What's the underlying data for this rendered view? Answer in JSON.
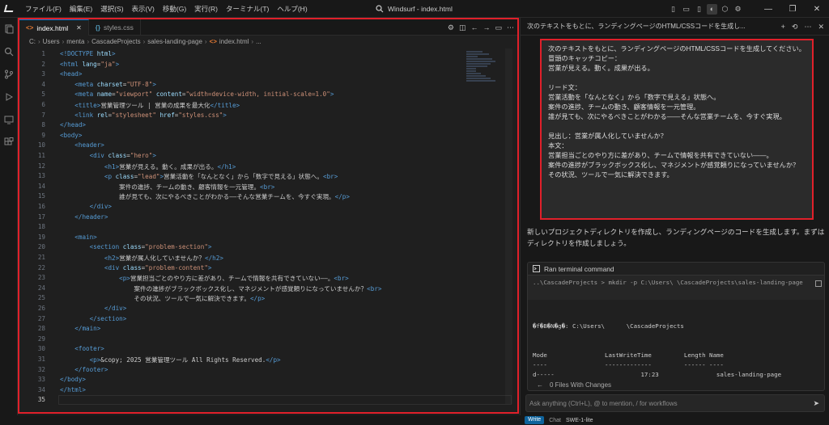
{
  "titlebar": {
    "menus": [
      "ファイル(F)",
      "編集(E)",
      "選択(S)",
      "表示(V)",
      "移動(G)",
      "実行(R)",
      "ターミナル(T)",
      "ヘルプ(H)"
    ],
    "search_text": "Windsurf - index.html",
    "window_controls": [
      "—",
      "❐",
      "✕"
    ]
  },
  "editor": {
    "tabs": [
      {
        "icon": "<>",
        "label": "index.html",
        "active": true
      },
      {
        "icon": "{}",
        "label": "styles.css",
        "active": false
      }
    ],
    "breadcrumb": [
      "C:",
      "Users",
      "menta",
      "CascadeProjects",
      "sales-landing-page",
      "index.html",
      "..."
    ],
    "current_line": 35,
    "lines": [
      [
        [
          "t",
          "<!DOCTYPE "
        ],
        [
          "a",
          "html"
        ],
        [
          "t",
          ">"
        ]
      ],
      [
        [
          "t",
          "<html "
        ],
        [
          "a",
          "lang"
        ],
        [
          "e",
          "="
        ],
        [
          "s",
          "\"ja\""
        ],
        [
          "t",
          ">"
        ]
      ],
      [
        [
          "t",
          "<head>"
        ]
      ],
      [
        [
          "e",
          "    "
        ],
        [
          "t",
          "<meta "
        ],
        [
          "a",
          "charset"
        ],
        [
          "e",
          "="
        ],
        [
          "s",
          "\"UTF-8\""
        ],
        [
          "t",
          ">"
        ]
      ],
      [
        [
          "e",
          "    "
        ],
        [
          "t",
          "<meta "
        ],
        [
          "a",
          "name"
        ],
        [
          "e",
          "="
        ],
        [
          "s",
          "\"viewport\""
        ],
        [
          "e",
          " "
        ],
        [
          "a",
          "content"
        ],
        [
          "e",
          "="
        ],
        [
          "s",
          "\"width=device-width, initial-scale=1.0\""
        ],
        [
          "t",
          ">"
        ]
      ],
      [
        [
          "e",
          "    "
        ],
        [
          "t",
          "<title>"
        ],
        [
          "e",
          "営業管理ツール | 営業の成果を最大化"
        ],
        [
          "t",
          "</title>"
        ]
      ],
      [
        [
          "e",
          "    "
        ],
        [
          "t",
          "<link "
        ],
        [
          "a",
          "rel"
        ],
        [
          "e",
          "="
        ],
        [
          "s",
          "\"stylesheet\""
        ],
        [
          "e",
          " "
        ],
        [
          "a",
          "href"
        ],
        [
          "e",
          "="
        ],
        [
          "s",
          "\"styles.css\""
        ],
        [
          "t",
          ">"
        ]
      ],
      [
        [
          "t",
          "</head>"
        ]
      ],
      [
        [
          "t",
          "<body>"
        ]
      ],
      [
        [
          "e",
          "    "
        ],
        [
          "t",
          "<header>"
        ]
      ],
      [
        [
          "e",
          "        "
        ],
        [
          "t",
          "<div "
        ],
        [
          "a",
          "class"
        ],
        [
          "e",
          "="
        ],
        [
          "s",
          "\"hero\""
        ],
        [
          "t",
          ">"
        ]
      ],
      [
        [
          "e",
          "            "
        ],
        [
          "t",
          "<h1>"
        ],
        [
          "e",
          "営業が見える。動く。成果が出る。"
        ],
        [
          "t",
          "</h1>"
        ]
      ],
      [
        [
          "e",
          "            "
        ],
        [
          "t",
          "<p "
        ],
        [
          "a",
          "class"
        ],
        [
          "e",
          "="
        ],
        [
          "s",
          "\"lead\""
        ],
        [
          "t",
          ">"
        ],
        [
          "e",
          "営業活動を「なんとなく」から「数字で見える」状態へ。"
        ],
        [
          "t",
          "<br>"
        ]
      ],
      [
        [
          "e",
          "                案件の進捗、チームの動き、顧客情報を一元管理。"
        ],
        [
          "t",
          "<br>"
        ]
      ],
      [
        [
          "e",
          "                誰が見ても、次にやるべきことがわかる——そんな営業チームを、今すぐ実現。"
        ],
        [
          "t",
          "</p>"
        ]
      ],
      [
        [
          "e",
          "        "
        ],
        [
          "t",
          "</div>"
        ]
      ],
      [
        [
          "e",
          "    "
        ],
        [
          "t",
          "</header>"
        ]
      ],
      [],
      [
        [
          "e",
          "    "
        ],
        [
          "t",
          "<main>"
        ]
      ],
      [
        [
          "e",
          "        "
        ],
        [
          "t",
          "<section "
        ],
        [
          "a",
          "class"
        ],
        [
          "e",
          "="
        ],
        [
          "s",
          "\"problem-section\""
        ],
        [
          "t",
          ">"
        ]
      ],
      [
        [
          "e",
          "            "
        ],
        [
          "t",
          "<h2>"
        ],
        [
          "e",
          "営業が属人化していませんか？"
        ],
        [
          "t",
          "</h2>"
        ]
      ],
      [
        [
          "e",
          "            "
        ],
        [
          "t",
          "<div "
        ],
        [
          "a",
          "class"
        ],
        [
          "e",
          "="
        ],
        [
          "s",
          "\"problem-content\""
        ],
        [
          "t",
          ">"
        ]
      ],
      [
        [
          "e",
          "                "
        ],
        [
          "t",
          "<p>"
        ],
        [
          "e",
          "営業担当ごとのやり方に差があり、チームで情報を共有できていない——。"
        ],
        [
          "t",
          "<br>"
        ]
      ],
      [
        [
          "e",
          "                    案件の進捗がブラックボックス化し、マネジメントが感覚頼りになっていませんか？"
        ],
        [
          "t",
          "<br>"
        ]
      ],
      [
        [
          "e",
          "                    その状況、ツールで一気に解決できます。"
        ],
        [
          "t",
          "</p>"
        ]
      ],
      [
        [
          "e",
          "            "
        ],
        [
          "t",
          "</div>"
        ]
      ],
      [
        [
          "e",
          "        "
        ],
        [
          "t",
          "</section>"
        ]
      ],
      [
        [
          "e",
          "    "
        ],
        [
          "t",
          "</main>"
        ]
      ],
      [],
      [
        [
          "e",
          "    "
        ],
        [
          "t",
          "<footer>"
        ]
      ],
      [
        [
          "e",
          "        "
        ],
        [
          "t",
          "<p>"
        ],
        [
          "e",
          "&copy; 2025 営業管理ツール All Rights Reserved."
        ],
        [
          "t",
          "</p>"
        ]
      ],
      [
        [
          "e",
          "    "
        ],
        [
          "t",
          "</footer>"
        ]
      ],
      [
        [
          "t",
          "</body>"
        ]
      ],
      [
        [
          "t",
          "</html>"
        ]
      ],
      []
    ]
  },
  "panel": {
    "header_title": "次のテキストをもとに、ランディングページのHTML/CSSコードを生成し...",
    "header_actions": [
      "+",
      "⟲",
      "⋯",
      "✕"
    ],
    "user_message": "次のテキストをもとに、ランディングページのHTML/CSSコードを生成してください。\n冒頭のキャッチコピー：\n営業が見える。動く。成果が出る。\n\nリード文：\n営業活動を「なんとなく」から「数字で見える」状態へ。\n案件の進捗、チームの動き、顧客情報を一元管理。\n誰が見ても、次にやるべきことがわかる——そんな営業チームを、今すぐ実現。\n\n見出し：営業が属人化していませんか？\n本文：\n営業担当ごとのやり方に差があり、チームで情報を共有できていない——。\n案件の進捗がブラックボックス化し、マネジメントが感覚頼りになっていませんか？\nその状況、ツールで一気に解決できます。",
    "assistant_text": "新しいプロジェクトディレクトリを作成し、ランディングページのコードを生成します。まずはディレクトリを作成しましょう。",
    "terminal": {
      "title": "Ran terminal command",
      "command": "..\\CascadeProjects > mkdir -p C:\\Users\\      \\CascadeProjects\\sales-landing-page",
      "garbled": "�f�B�N�g�: C:\\Users\\      \\CascadeProjects",
      "columns": "Mode                LastWriteTime         Length Name",
      "dashes": "----                -------------         ------ ----",
      "row": "d-----                        17:23                sales-landing-page"
    },
    "files_changed": "0 Files With Changes",
    "ask_placeholder": "Ask anything (Ctrl+L), @ to mention, / for workflows",
    "footer": {
      "write": "Write",
      "chat": "Chat",
      "model": "SWE-1-lite"
    }
  }
}
